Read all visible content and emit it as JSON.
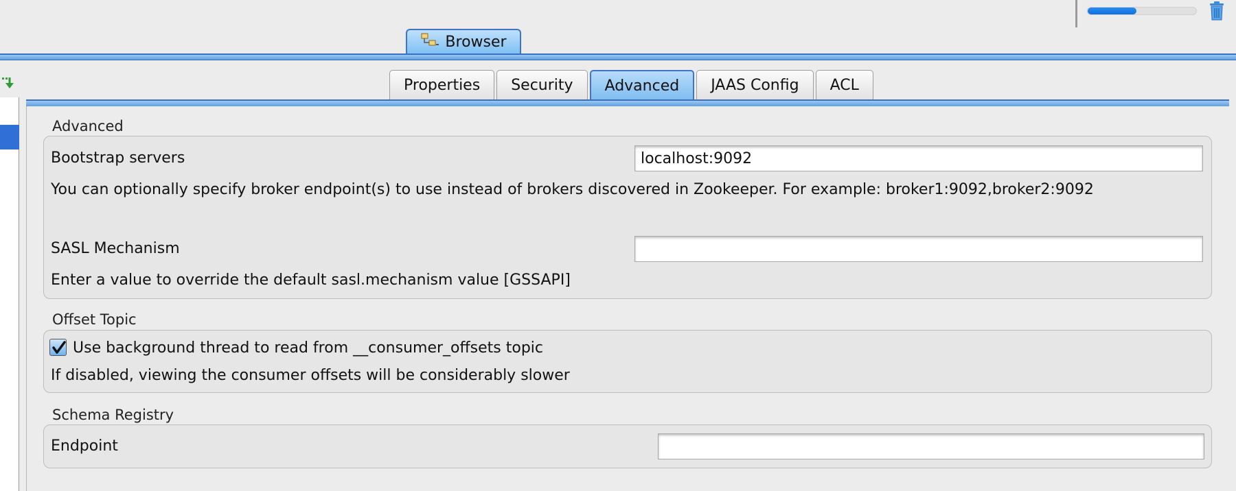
{
  "toolbar": {
    "progress_fraction": 0.45,
    "trash_icon": "trash-icon"
  },
  "browser_tab": {
    "label": "Browser",
    "icon": "tree-browser-icon"
  },
  "left_toolbar": {
    "icon": "import-arrow-icon"
  },
  "tabs": [
    {
      "label": "Properties",
      "active": false
    },
    {
      "label": "Security",
      "active": false
    },
    {
      "label": "Advanced",
      "active": true
    },
    {
      "label": "JAAS Config",
      "active": false
    },
    {
      "label": "ACL",
      "active": false
    }
  ],
  "advanced": {
    "title": "Advanced",
    "bootstrap_label": "Bootstrap servers",
    "bootstrap_value": "localhost:9092",
    "bootstrap_help": "You can optionally specify broker endpoint(s) to use instead of brokers discovered in Zookeeper. For example: broker1:9092,broker2:9092",
    "sasl_label": "SASL Mechanism",
    "sasl_value": "",
    "sasl_help": "Enter a value to override the default sasl.mechanism value [GSSAPI]"
  },
  "offset_topic": {
    "title": "Offset Topic",
    "checkbox_label": "Use background thread to read from __consumer_offsets topic",
    "checked": true,
    "help": "If disabled, viewing the consumer offsets will be considerably slower"
  },
  "schema_registry": {
    "title": "Schema Registry",
    "endpoint_label": "Endpoint",
    "endpoint_value": ""
  },
  "colors": {
    "accent": "#3f74c8",
    "tab_active": "#7fbdf0",
    "progress": "#1a7ee8"
  }
}
